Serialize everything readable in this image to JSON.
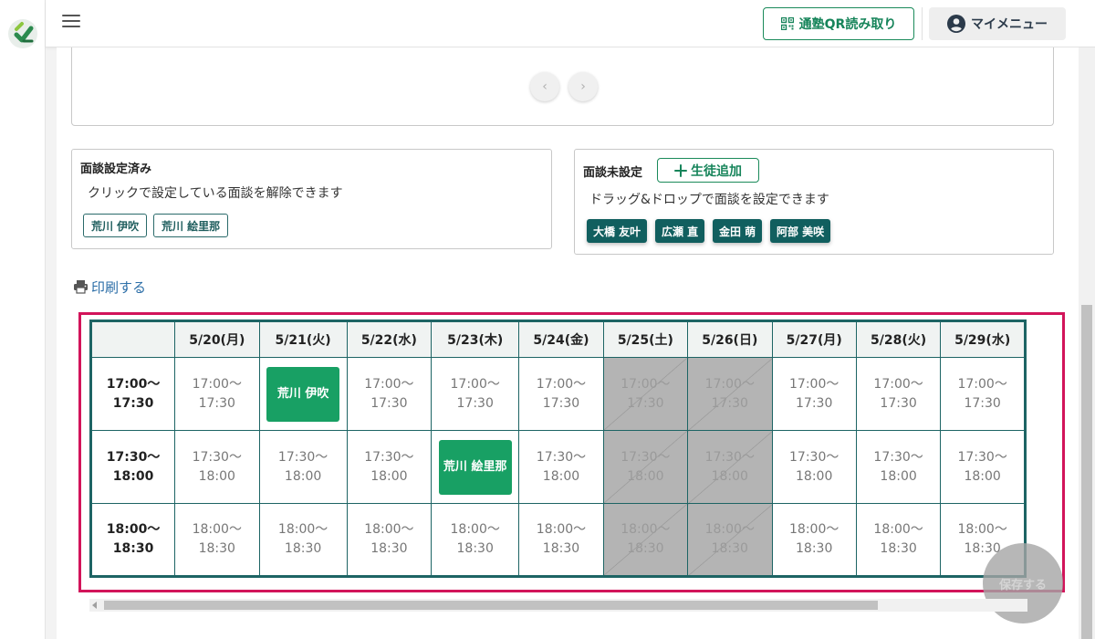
{
  "header": {
    "qr_button_label": "通塾QR読み取り",
    "my_menu_label": "マイメニュー"
  },
  "navigation": {
    "prev_arrow": "‹",
    "next_arrow": "›"
  },
  "scheduled": {
    "title": "面談設定済み",
    "description": "クリックで設定している面談を解除できます",
    "students": [
      "荒川 伊吹",
      "荒川 絵里那"
    ]
  },
  "unscheduled": {
    "title": "面談未設定",
    "add_button_label": "生徒追加",
    "description": "ドラッグ&ドロップで面談を設定できます",
    "students": [
      "大橋 友叶",
      "広瀬 直",
      "金田 萌",
      "阿部 美咲"
    ]
  },
  "print_label": "印刷する",
  "schedule": {
    "dates": [
      "5/20(月)",
      "5/21(火)",
      "5/22(水)",
      "5/23(木)",
      "5/24(金)",
      "5/25(土)",
      "5/26(日)",
      "5/27(月)",
      "5/28(火)",
      "5/29(水)"
    ],
    "slots": [
      {
        "start": "17:00〜",
        "end": "17:30"
      },
      {
        "start": "17:30〜",
        "end": "18:00"
      },
      {
        "start": "18:00〜",
        "end": "18:30"
      }
    ],
    "unavailable_columns": [
      5,
      6
    ],
    "bookings": [
      {
        "row": 0,
        "col": 1,
        "student": "荒川 伊吹"
      },
      {
        "row": 1,
        "col": 3,
        "student": "荒川 絵里那"
      }
    ]
  },
  "save_label": "保存する",
  "colors": {
    "brand_green": "#16845a",
    "table_border": "#1d6464",
    "highlight": "#d2145a",
    "booked": "#18a064"
  }
}
